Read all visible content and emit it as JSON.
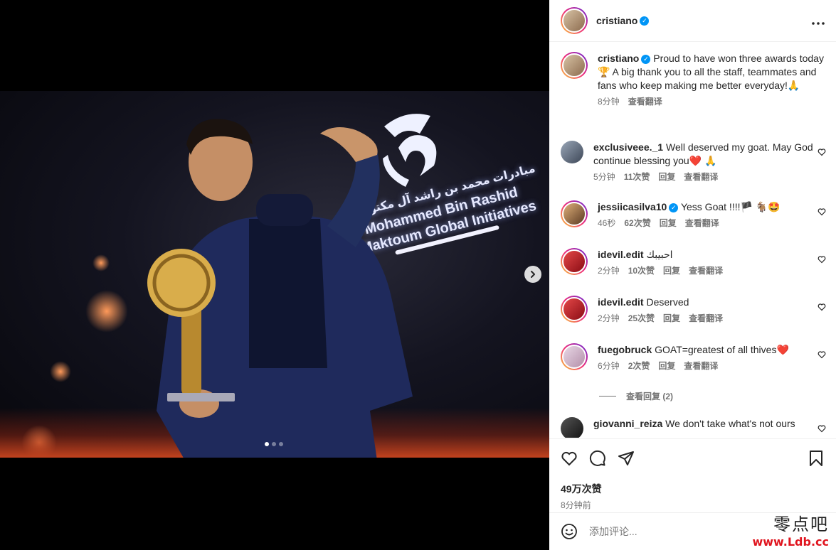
{
  "post": {
    "author": "cristiano",
    "verified": true,
    "caption": "Proud to have won three awards today 🏆 A big thank you to all the staff, teammates and fans who keep making me better everyday!🙏",
    "caption_time": "8分钟",
    "caption_translate": "查看翻译",
    "photo_text": {
      "arabic": "مبادرات محمد بن راشد آل مكتوم",
      "line1": "Mohammed Bin Rashid",
      "line2": "Al Maktoum Global Initiatives"
    },
    "carousel": {
      "count": 3,
      "active_index": 0
    }
  },
  "comments": [
    {
      "user": "exclusiveee._1",
      "verified": false,
      "text": "Well deserved my goat. May God continue blessing you❤️ 🙏",
      "time": "5分钟",
      "likes": "11次赞",
      "reply": "回复",
      "translate": "查看翻译"
    },
    {
      "user": "jessiicasilva10",
      "verified": true,
      "text": "Yess Goat !!!!🏴 🐐🤩",
      "time": "46秒",
      "likes": "62次赞",
      "reply": "回复",
      "translate": "查看翻译"
    },
    {
      "user": "idevil.edit",
      "verified": false,
      "text": "احبيبك",
      "time": "2分钟",
      "likes": "10次赞",
      "reply": "回复",
      "translate": "查看翻译"
    },
    {
      "user": "idevil.edit",
      "verified": false,
      "text": "Deserved",
      "time": "2分钟",
      "likes": "25次赞",
      "reply": "回复",
      "translate": "查看翻译"
    },
    {
      "user": "fuegobruck",
      "verified": false,
      "text": "GOAT=greatest of all thives❤️",
      "time": "6分钟",
      "likes": "2次赞",
      "reply": "回复",
      "translate": "查看翻译"
    },
    {
      "user": "giovanni_reiza",
      "verified": false,
      "text": "We don't take what's not ours",
      "time": "",
      "likes": "",
      "reply": "",
      "translate": ""
    }
  ],
  "view_replies": "查看回复 (2)",
  "stats": {
    "likes": "49万次赞",
    "posted": "8分钟前"
  },
  "add_comment": {
    "placeholder": "添加评论..."
  },
  "watermark": {
    "cn": "零点吧",
    "url": "www.Ldb.cc"
  },
  "icons": {
    "more": "more-horizontal-icon",
    "like": "heart-icon",
    "comment": "comment-bubble-icon",
    "share": "send-icon",
    "save": "bookmark-icon",
    "emoji": "emoji-icon",
    "next": "chevron-right-icon"
  },
  "colors": {
    "verified": "#0095f6",
    "link_muted": "#737373",
    "text": "#262626"
  }
}
